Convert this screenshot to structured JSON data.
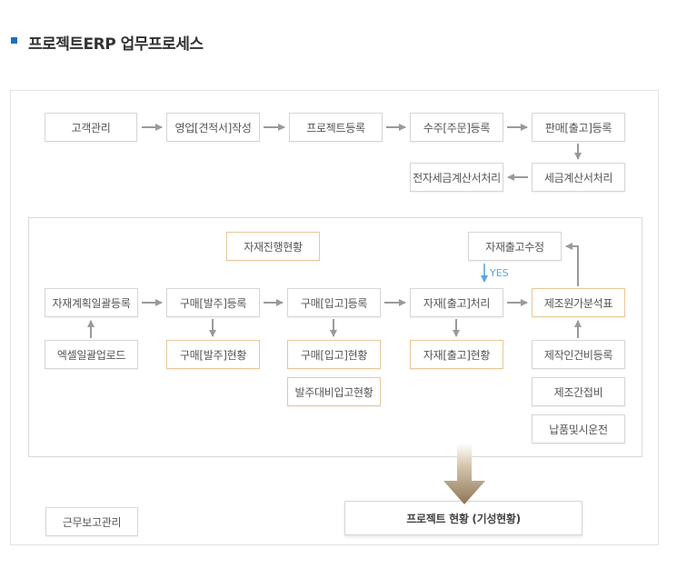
{
  "page": {
    "title": "프로젝트ERP 업무프로세스"
  },
  "nodes": {
    "customer": "고객관리",
    "sales_estimate": "영업[견적서]작성",
    "project_reg": "프로젝트등록",
    "order_reg": "수주[주문]등록",
    "sale_ship_reg": "판매[출고]등록",
    "tax_invoice": "세금계산서처리",
    "e_tax_invoice": "전자세금계산서처리",
    "material_progress": "자재진행현황",
    "material_ship_edit": "자재출고수정",
    "material_plan_bulk": "자재계획일괄등록",
    "excel_upload": "엑셀일괄업로드",
    "purchase_order_reg": "구매[발주]등록",
    "purchase_order_status": "구매[발주]현황",
    "purchase_in_reg": "구매[입고]등록",
    "purchase_in_status": "구매[입고]현황",
    "order_vs_in_status": "발주대비입고현황",
    "material_out_proc": "자재[출고]처리",
    "material_out_status": "자재[출고]현황",
    "mfg_cost_table": "제조원가분석표",
    "mfg_labor_reg": "제작인건비등록",
    "mfg_indirect": "제조간접비",
    "delivery_test": "납품및시운전",
    "work_report": "근무보고관리",
    "project_status": "프로젝트 현황 (기성현황)"
  },
  "labels": {
    "yes": "YES"
  },
  "colors": {
    "title_bullet": "#1a6fc4",
    "highlight_border": "#e8c89a",
    "yes_arrow": "#5aa6dd",
    "arrow": "#9a9a9a"
  }
}
